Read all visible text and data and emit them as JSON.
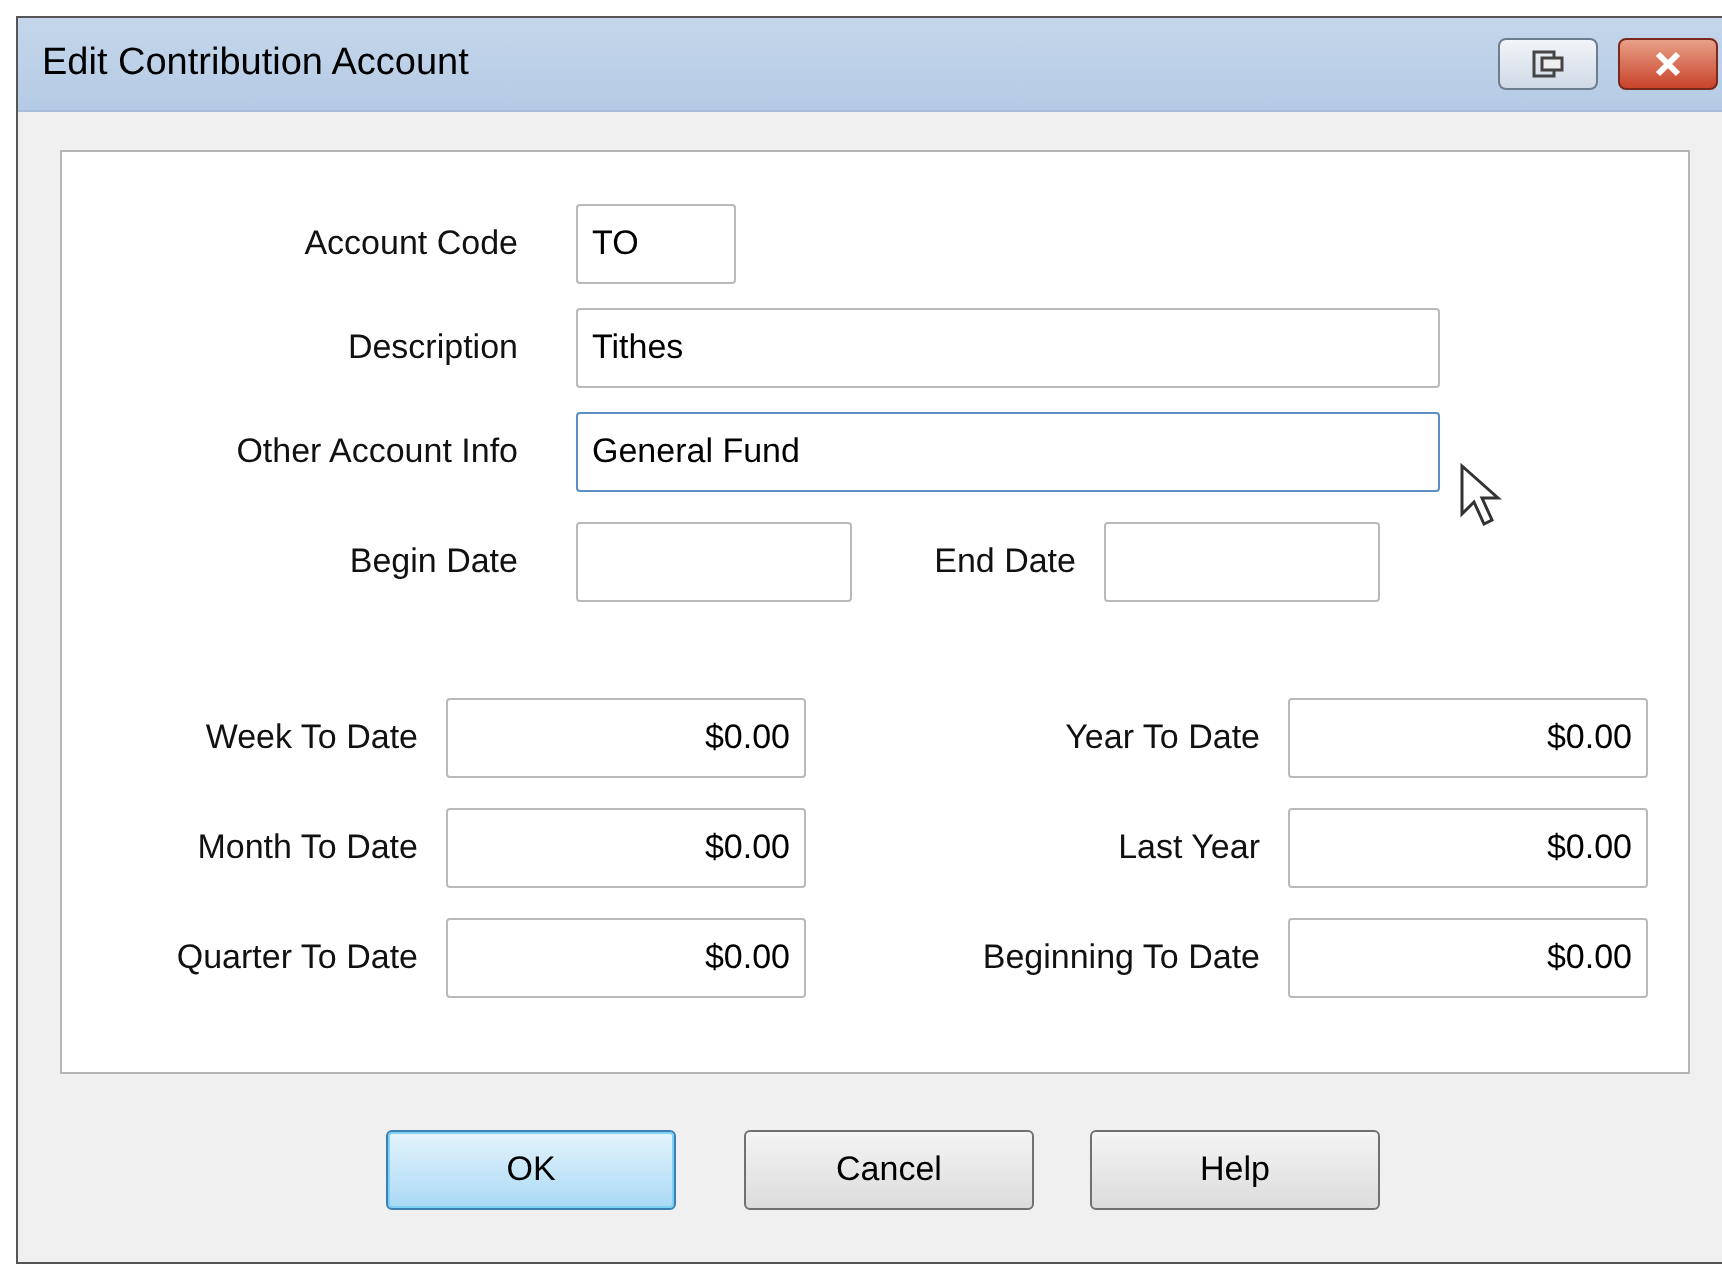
{
  "window": {
    "title": "Edit Contribution Account"
  },
  "fields": [
    {
      "kind": "short",
      "label": "Account Code",
      "value": "TO",
      "focused": false
    },
    {
      "kind": "wide",
      "label": "Description",
      "value": "Tithes",
      "focused": false
    },
    {
      "kind": "wide",
      "label": "Other Account Info",
      "value": "General Fund",
      "focused": true
    }
  ],
  "dates": [
    {
      "label": "Begin Date"
    },
    {
      "label": "End Date"
    }
  ],
  "totals": [
    {
      "label": "Week To Date",
      "value": "$0.00"
    },
    {
      "label": "Year To Date",
      "value": "$0.00"
    },
    {
      "label": "Month To Date",
      "value": "$0.00"
    },
    {
      "label": "Last Year",
      "value": "$0.00"
    },
    {
      "label": "Quarter To Date",
      "value": "$0.00"
    },
    {
      "label": "Beginning To Date",
      "value": "$0.00"
    }
  ],
  "buttons": [
    {
      "label": "OK",
      "default": true
    },
    {
      "label": "Cancel",
      "default": false
    },
    {
      "label": "Help",
      "default": false
    }
  ]
}
